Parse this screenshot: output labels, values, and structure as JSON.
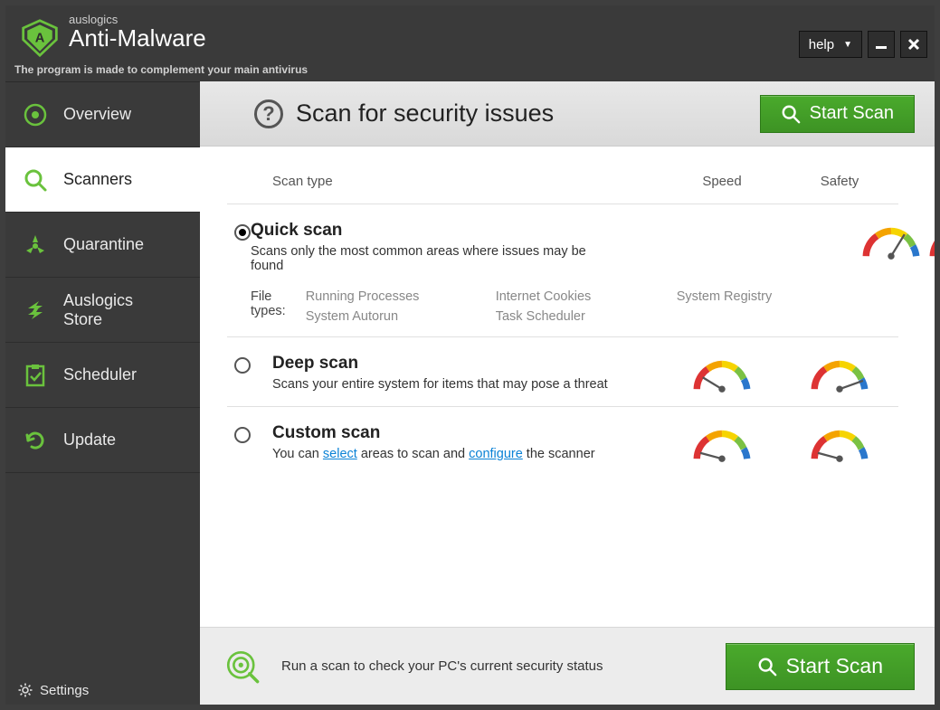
{
  "brand": {
    "company": "auslogics",
    "product": "Anti-Malware",
    "tagline": "The program is made to complement your main antivirus"
  },
  "titlebar": {
    "help_label": "help"
  },
  "sidebar": {
    "items": [
      {
        "label": "Overview"
      },
      {
        "label": "Scanners"
      },
      {
        "label": "Quarantine"
      },
      {
        "label": "Auslogics Store"
      },
      {
        "label": "Scheduler"
      },
      {
        "label": "Update"
      }
    ],
    "settings_label": "Settings"
  },
  "page": {
    "title": "Scan for security issues",
    "start_scan_label": "Start Scan"
  },
  "columns": {
    "type": "Scan type",
    "speed": "Speed",
    "safety": "Safety"
  },
  "scans": {
    "quick": {
      "name": "Quick scan",
      "desc": "Scans only the most common areas where issues may be found",
      "file_types_label": "File types:",
      "file_types": [
        "Running Processes",
        "Internet Cookies",
        "System Registry",
        "System Autorun",
        "Task Scheduler"
      ]
    },
    "deep": {
      "name": "Deep scan",
      "desc": "Scans your entire system for items that may pose a threat"
    },
    "custom": {
      "name": "Custom scan",
      "desc_pre": "You can ",
      "desc_link1": "select",
      "desc_mid": " areas to scan and ",
      "desc_link2": "configure",
      "desc_post": " the scanner"
    }
  },
  "footer": {
    "text": "Run a scan to check your PC's current security status",
    "start_scan_label": "Start Scan"
  }
}
